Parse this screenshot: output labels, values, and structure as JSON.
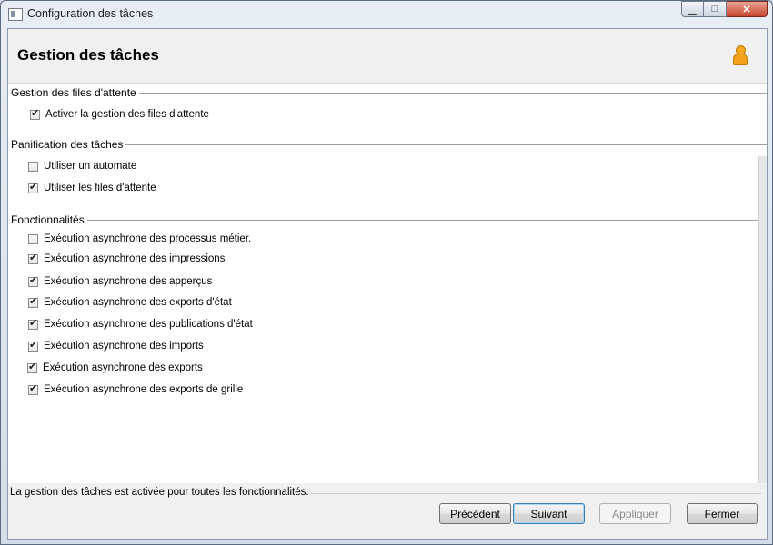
{
  "window": {
    "title": "Configuration des tâches"
  },
  "header": {
    "title": "Gestion des tâches",
    "icon": "user-icon"
  },
  "sections": [
    {
      "title": "Gestion des files d'attente",
      "items": [
        {
          "label": "Activer la gestion des files d'attente",
          "checked": true
        }
      ]
    },
    {
      "title": "Panification des tâches",
      "items": [
        {
          "label": "Utiliser un automate",
          "checked": false
        },
        {
          "label": "Utiliser les files d'attente",
          "checked": true
        }
      ]
    },
    {
      "title": "Fonctionnalités",
      "items": [
        {
          "label": "Exécution asynchrone des processus métier.",
          "checked": false
        },
        {
          "label": "Exécution asynchrone des impressions",
          "checked": true
        },
        {
          "label": "Exécution asynchrone des apperçus",
          "checked": true
        },
        {
          "label": "Exécution asynchrone des exports d'état",
          "checked": true
        },
        {
          "label": "Exécution asynchrone des publications d'état",
          "checked": true
        },
        {
          "label": "Exécution asynchrone des imports",
          "checked": true
        },
        {
          "label": "Exécution asynchrone des exports",
          "checked": true
        },
        {
          "label": "Exécution asynchrone des exports de grille",
          "checked": true
        }
      ]
    }
  ],
  "status": {
    "text": "La gestion des tâches est activée pour toutes les fonctionnalités."
  },
  "buttons": {
    "previous": "Précédent",
    "next": "Suivant",
    "apply": "Appliquer",
    "close": "Fermer"
  }
}
